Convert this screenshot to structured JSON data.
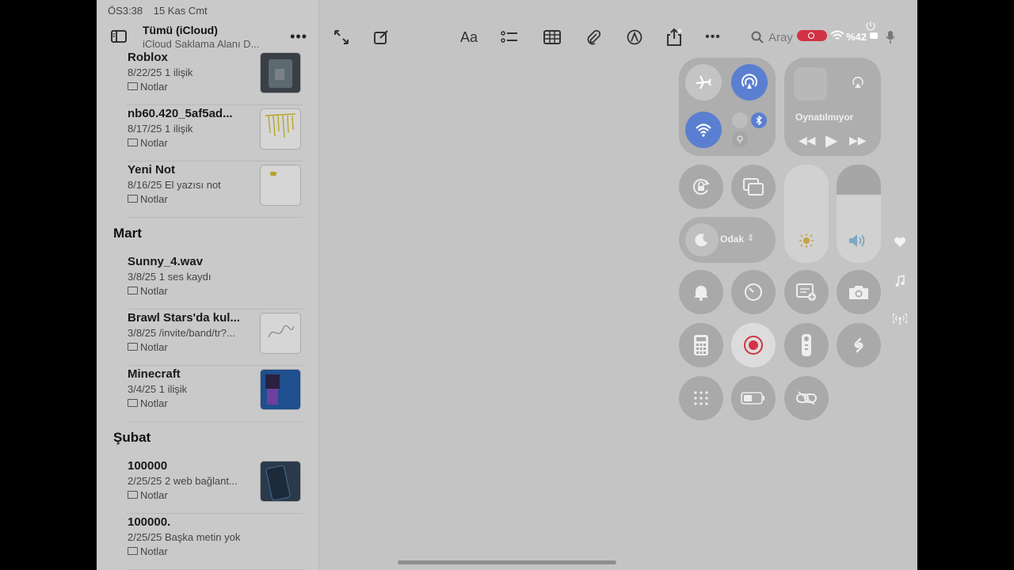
{
  "status": {
    "time": "ÖS3:38",
    "date": "15 Kas Cmt",
    "battery": "%42"
  },
  "sidebar": {
    "title": "Tümü (iCloud)",
    "subtitle": "iCloud Saklama Alanı D...",
    "sections": [
      {
        "label": "Mart"
      },
      {
        "label": "Şubat"
      }
    ],
    "notes": [
      {
        "title": "Roblox",
        "meta": "8/22/25  1 ilişik",
        "folder": "Notlar"
      },
      {
        "title": "nb60.420_5af5ad...",
        "meta": "8/17/25  1 ilişik",
        "folder": "Notlar"
      },
      {
        "title": "Yeni Not",
        "meta": "8/16/25  El yazısı not",
        "folder": "Notlar"
      },
      {
        "title": "Sunny_4.wav",
        "meta": "3/8/25  1 ses kaydı",
        "folder": "Notlar"
      },
      {
        "title": "Brawl Stars'da kul...",
        "meta": "3/8/25  /invite/band/tr?...",
        "folder": "Notlar"
      },
      {
        "title": "Minecraft",
        "meta": "3/4/25  1 ilişik",
        "folder": "Notlar"
      },
      {
        "title": "100000",
        "meta": "2/25/25  2 web bağlant...",
        "folder": "Notlar"
      },
      {
        "title": "100000.",
        "meta": "2/25/25  Başka metin yok",
        "folder": "Notlar"
      }
    ]
  },
  "toolbar": {
    "format_label": "Aa",
    "search_placeholder": "Aray"
  },
  "control_center": {
    "now_playing": "Oynatılmıyor",
    "focus_label": "Odak",
    "accent": "#5b7fd0",
    "record_color": "#d23246"
  }
}
